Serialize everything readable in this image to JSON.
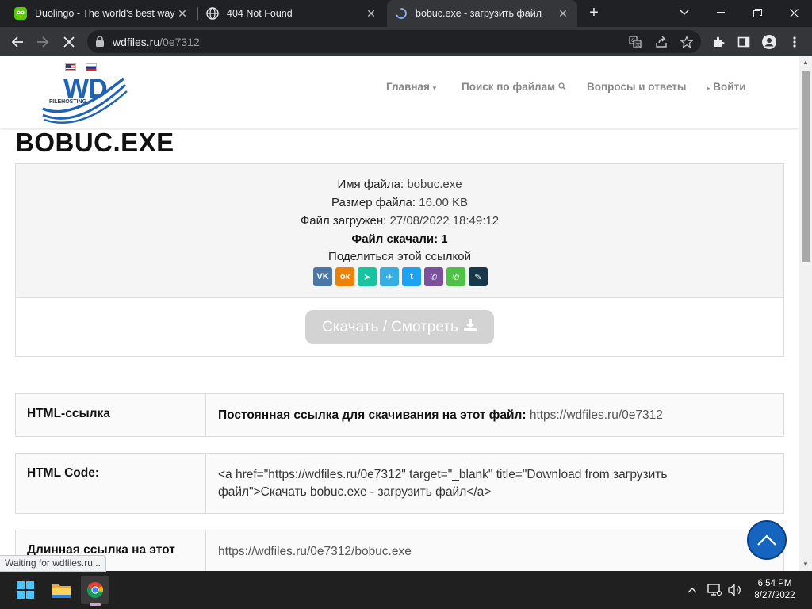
{
  "browser": {
    "tabs": [
      {
        "title": "Duolingo - The world's best way",
        "favicon": "duolingo-icon"
      },
      {
        "title": "404 Not Found",
        "favicon": "globe-icon"
      },
      {
        "title": "bobuc.exe - загрузить файл",
        "favicon": "loading-spinner-icon"
      }
    ],
    "new_tab": "+",
    "url_host": "wdfiles.ru",
    "url_path": "/0e7312",
    "status_text": "Waiting for wdfiles.ru..."
  },
  "site": {
    "logo_text": "WD",
    "logo_sub": "FILEHOSTING",
    "nav": {
      "home": "Главная",
      "search": "Поиск по файлам",
      "faq": "Вопросы и ответы",
      "login": "Войти"
    }
  },
  "file": {
    "title": "BOBUC.EXE",
    "name_label": "Имя файла:",
    "name_value": "bobuc.exe",
    "size_label": "Размер файла:",
    "size_value": "16.00 KB",
    "uploaded_label": "Файл загружен:",
    "uploaded_value": "27/08/2022 18:49:12",
    "downloads": "Файл скачали: 1",
    "share_label": "Поделиться этой ссылкой",
    "share_icons": [
      {
        "name": "vk",
        "glyph": "VK",
        "color": "#4a76a8"
      },
      {
        "name": "odnoklassniki",
        "glyph": "ок",
        "color": "#ee8208"
      },
      {
        "name": "sms",
        "glyph": "➤",
        "color": "#18c4a0"
      },
      {
        "name": "telegram",
        "glyph": "✈",
        "color": "#37aee2"
      },
      {
        "name": "twitter",
        "glyph": "t",
        "color": "#1da1f2"
      },
      {
        "name": "viber",
        "glyph": "✆",
        "color": "#7b519d"
      },
      {
        "name": "whatsapp",
        "glyph": "✆",
        "color": "#4dc247"
      },
      {
        "name": "livejournal",
        "glyph": "✎",
        "color": "#16384a"
      }
    ],
    "download_button": "Скачать / Смотреть"
  },
  "table": {
    "row1_label": "HTML-ссылка",
    "row1_bold": "Постоянная ссылка для скачивания на этот файл:",
    "row1_link": "https://wdfiles.ru/0e7312",
    "row2_label": "HTML Code:",
    "row2_code_l1": "<a href=\"https://wdfiles.ru/0e7312\" target=\"_blank\" title=\"Download from загрузить",
    "row2_code_l2": "файл\">Скачать bobuc.exe - загрузить файл</a>",
    "row3_label": "Длинная ссылка на этот",
    "row3_value": "https://wdfiles.ru/0e7312/bobuc.exe"
  },
  "taskbar": {
    "time": "6:54 PM",
    "date": "8/27/2022"
  },
  "colors": {
    "accent_blue": "#1565c0",
    "chrome_dark": "#202124",
    "chrome_toolbar": "#35363a"
  }
}
